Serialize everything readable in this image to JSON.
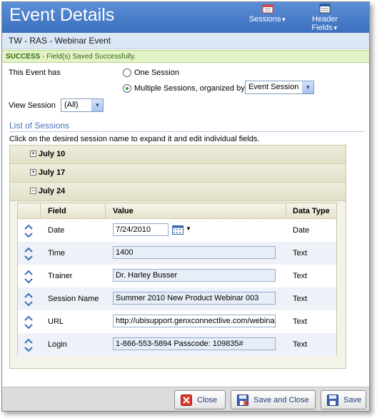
{
  "header": {
    "title": "Event Details",
    "menus": [
      {
        "label": "Sessions",
        "icon": "sessions-icon"
      },
      {
        "label": "Header Fields",
        "icon": "header-fields-icon"
      }
    ]
  },
  "subheader": {
    "event_name": "TW - RAS - Webinar Event"
  },
  "status": {
    "prefix": "SUCCESS",
    "separator": " - ",
    "message": "Field(s) Saved Successfully."
  },
  "event_options": {
    "label": "This Event has",
    "one_session_label": "One Session",
    "multiple_sessions_label": "Multiple Sessions, organized by",
    "selected": "multiple",
    "organize_by_value": "Event Session"
  },
  "view_session": {
    "label": "View Session",
    "value": "(All)"
  },
  "list": {
    "title": "List of Sessions",
    "hint": "Click on the desired session name to expand it and edit individual fields.",
    "groups": [
      {
        "label": "July 10",
        "expanded": false,
        "toggle": "+"
      },
      {
        "label": "July 17",
        "expanded": false,
        "toggle": "+"
      },
      {
        "label": "July 24",
        "expanded": true,
        "toggle": "−"
      }
    ]
  },
  "table": {
    "columns": [
      "Field",
      "Value",
      "Data Type"
    ],
    "rows": [
      {
        "field": "Date",
        "value": "7/24/2010",
        "type": "Date"
      },
      {
        "field": "Time",
        "value": "1400",
        "type": "Text"
      },
      {
        "field": "Trainer",
        "value": "Dr. Harley Busser",
        "type": "Text"
      },
      {
        "field": "Session Name",
        "value": "Summer 2010 New Product Webinar 003",
        "type": "Text"
      },
      {
        "field": "URL",
        "value": "http://ubisupport.genxconnectlive.com/webinar",
        "type": "Text"
      },
      {
        "field": "Login",
        "value": "1-866-553-5894  Passcode: 109835#",
        "type": "Text"
      }
    ]
  },
  "footer": {
    "close_label": "Close",
    "save_close_label": "Save and Close",
    "save_label": "Save"
  },
  "colors": {
    "header_blue": "#3c6fbd",
    "success_green": "#2f6b10",
    "radio_checked": "#2c9e22"
  }
}
